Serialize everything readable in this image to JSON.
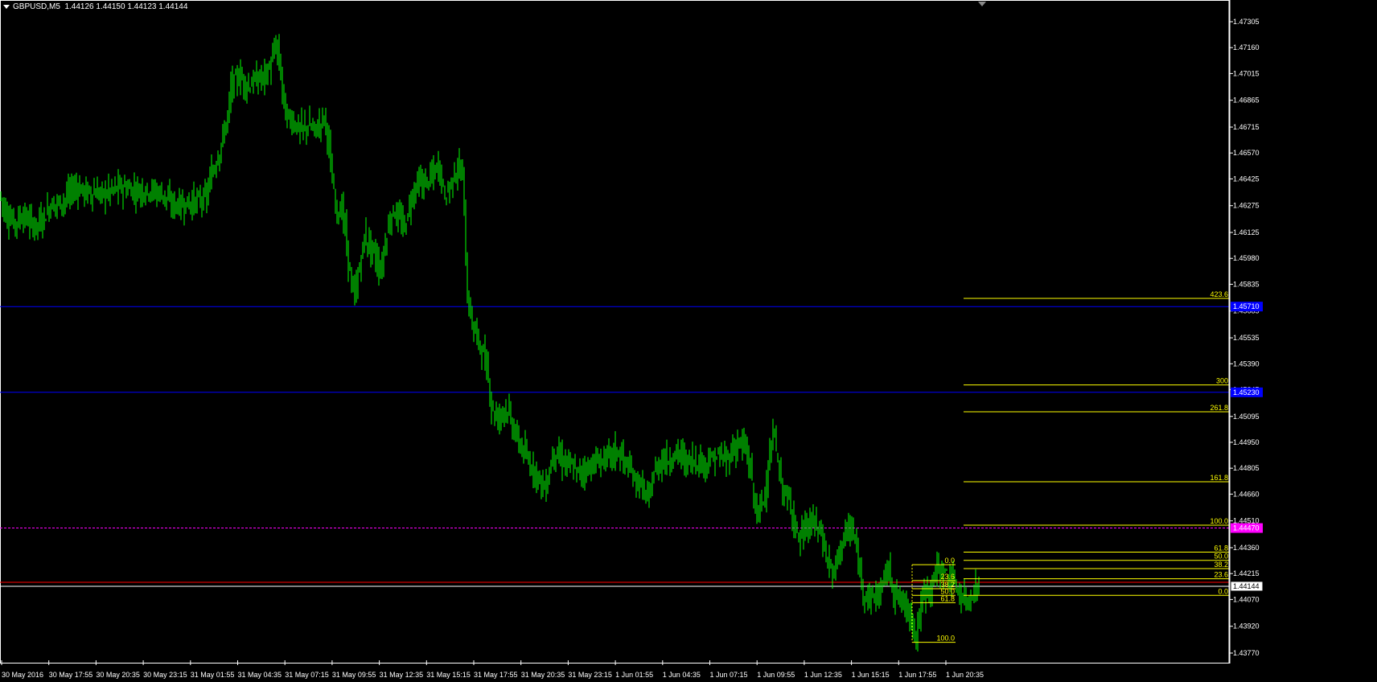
{
  "header": {
    "symbol": "GBPUSD,M5",
    "ohlc": "1.44126 1.44150 1.44123 1.44144"
  },
  "colors": {
    "background": "#000000",
    "candles": "#00ff00",
    "axis": "#ffffff",
    "support_line": "#0000ff",
    "fib": "#ffff00",
    "dashed_line": "#ff00ff",
    "bid_line": "#ff0000"
  },
  "chart_data": {
    "type": "bar",
    "symbol": "GBPUSD,M5",
    "ylim": [
      1.437,
      1.4738
    ],
    "y_ticks": [
      "1.47305",
      "1.47160",
      "1.47015",
      "1.46865",
      "1.46715",
      "1.46570",
      "1.46425",
      "1.46275",
      "1.46125",
      "1.45980",
      "1.45835",
      "1.45685",
      "1.45535",
      "1.45390",
      "1.45245",
      "1.45095",
      "1.44950",
      "1.44805",
      "1.44660",
      "1.44510",
      "1.44360",
      "1.44215",
      "1.44070",
      "1.43920",
      "1.43770"
    ],
    "x_ticks": [
      "30 May 2016",
      "30 May 17:55",
      "30 May 20:35",
      "30 May 23:15",
      "31 May 01:55",
      "31 May 04:35",
      "31 May 07:15",
      "31 May 09:55",
      "31 May 12:35",
      "31 May 15:15",
      "31 May 17:55",
      "31 May 20:35",
      "31 May 23:15",
      "1 Jun 01:55",
      "1 Jun 04:35",
      "1 Jun 07:15",
      "1 Jun 09:55",
      "1 Jun 12:35",
      "1 Jun 15:15",
      "1 Jun 17:55",
      "1 Jun 20:35"
    ],
    "x_range": [
      0,
      1522
    ],
    "price_path": [
      [
        0,
        1.4636
      ],
      [
        10,
        1.4622
      ],
      [
        20,
        1.4618
      ],
      [
        30,
        1.4622
      ],
      [
        45,
        1.4616
      ],
      [
        55,
        1.462
      ],
      [
        65,
        1.4628
      ],
      [
        80,
        1.463
      ],
      [
        95,
        1.4638
      ],
      [
        110,
        1.4635
      ],
      [
        130,
        1.4634
      ],
      [
        150,
        1.4638
      ],
      [
        170,
        1.4636
      ],
      [
        190,
        1.4636
      ],
      [
        205,
        1.4634
      ],
      [
        215,
        1.4628
      ],
      [
        230,
        1.4628
      ],
      [
        245,
        1.463
      ],
      [
        258,
        1.4632
      ],
      [
        265,
        1.4645
      ],
      [
        275,
        1.4658
      ],
      [
        285,
        1.4678
      ],
      [
        290,
        1.4696
      ],
      [
        300,
        1.47
      ],
      [
        310,
        1.4694
      ],
      [
        320,
        1.4698
      ],
      [
        330,
        1.47
      ],
      [
        338,
        1.4705
      ],
      [
        345,
        1.4718
      ],
      [
        350,
        1.4705
      ],
      [
        357,
        1.4678
      ],
      [
        365,
        1.4675
      ],
      [
        375,
        1.467
      ],
      [
        385,
        1.4672
      ],
      [
        395,
        1.467
      ],
      [
        405,
        1.4678
      ],
      [
        410,
        1.4665
      ],
      [
        415,
        1.464
      ],
      [
        420,
        1.4625
      ],
      [
        428,
        1.4625
      ],
      [
        433,
        1.4605
      ],
      [
        438,
        1.4585
      ],
      [
        442,
        1.4576
      ],
      [
        448,
        1.459
      ],
      [
        455,
        1.461
      ],
      [
        462,
        1.4605
      ],
      [
        468,
        1.46
      ],
      [
        475,
        1.459
      ],
      [
        482,
        1.461
      ],
      [
        490,
        1.4625
      ],
      [
        498,
        1.462
      ],
      [
        505,
        1.4615
      ],
      [
        512,
        1.463
      ],
      [
        520,
        1.464
      ],
      [
        530,
        1.464
      ],
      [
        540,
        1.4645
      ],
      [
        548,
        1.465
      ],
      [
        555,
        1.4632
      ],
      [
        562,
        1.464
      ],
      [
        570,
        1.4648
      ],
      [
        578,
        1.4645
      ],
      [
        580,
        1.4608
      ],
      [
        583,
        1.4575
      ],
      [
        590,
        1.456
      ],
      [
        600,
        1.4548
      ],
      [
        608,
        1.4535
      ],
      [
        613,
        1.4515
      ],
      [
        620,
        1.4508
      ],
      [
        630,
        1.4515
      ],
      [
        635,
        1.451
      ],
      [
        642,
        1.45
      ],
      [
        650,
        1.4492
      ],
      [
        660,
        1.4483
      ],
      [
        670,
        1.4477
      ],
      [
        680,
        1.4468
      ],
      [
        690,
        1.449
      ],
      [
        700,
        1.4485
      ],
      [
        710,
        1.4482
      ],
      [
        720,
        1.4478
      ],
      [
        730,
        1.448
      ],
      [
        740,
        1.4483
      ],
      [
        750,
        1.4485
      ],
      [
        760,
        1.4488
      ],
      [
        770,
        1.449
      ],
      [
        780,
        1.4483
      ],
      [
        790,
        1.4475
      ],
      [
        800,
        1.447
      ],
      [
        808,
        1.4462
      ],
      [
        815,
        1.4478
      ],
      [
        825,
        1.4485
      ],
      [
        835,
        1.4485
      ],
      [
        845,
        1.449
      ],
      [
        855,
        1.4484
      ],
      [
        865,
        1.4485
      ],
      [
        875,
        1.4483
      ],
      [
        885,
        1.4485
      ],
      [
        895,
        1.4487
      ],
      [
        905,
        1.4485
      ],
      [
        912,
        1.449
      ],
      [
        920,
        1.4495
      ],
      [
        928,
        1.4492
      ],
      [
        935,
        1.448
      ],
      [
        940,
        1.446
      ],
      [
        945,
        1.4455
      ],
      [
        952,
        1.4465
      ],
      [
        958,
        1.4485
      ],
      [
        965,
        1.45
      ],
      [
        970,
        1.4478
      ],
      [
        978,
        1.4465
      ],
      [
        985,
        1.446
      ],
      [
        995,
        1.444
      ],
      [
        1005,
        1.4448
      ],
      [
        1015,
        1.445
      ],
      [
        1022,
        1.4445
      ],
      [
        1030,
        1.443
      ],
      [
        1038,
        1.442
      ],
      [
        1045,
        1.4435
      ],
      [
        1055,
        1.4445
      ],
      [
        1062,
        1.4446
      ],
      [
        1068,
        1.443
      ],
      [
        1075,
        1.4412
      ],
      [
        1085,
        1.4408
      ],
      [
        1095,
        1.441
      ],
      [
        1105,
        1.4425
      ],
      [
        1115,
        1.441
      ],
      [
        1125,
        1.4405
      ],
      [
        1135,
        1.4398
      ],
      [
        1141,
        1.4385
      ],
      [
        1145,
        1.4398
      ],
      [
        1150,
        1.441
      ],
      [
        1160,
        1.4415
      ],
      [
        1168,
        1.4425
      ],
      [
        1175,
        1.4422
      ],
      [
        1185,
        1.4418
      ],
      [
        1195,
        1.441
      ],
      [
        1203,
        1.4406
      ],
      [
        1210,
        1.441
      ],
      [
        1218,
        1.4414
      ]
    ],
    "horizontal_lines": [
      {
        "price": 1.4571,
        "color": "#0000ff",
        "label": "1.45710"
      },
      {
        "price": 1.4523,
        "color": "#0000ff",
        "label": "1.45230"
      },
      {
        "price": 1.4447,
        "color": "#ff00ff",
        "label": "1.44470",
        "dashed": true
      },
      {
        "price": 1.44166,
        "color": "#ff0000"
      },
      {
        "price": 1.44144,
        "color": "#ffffff",
        "label": "1.44144"
      }
    ],
    "fib_large": {
      "x_start": 1198,
      "x_end": 1528,
      "levels": [
        {
          "label": "423.6",
          "price": 1.45756
        },
        {
          "label": "300",
          "price": 1.45271
        },
        {
          "label": "261.8",
          "price": 1.45121
        },
        {
          "label": "161.8",
          "price": 1.44729
        },
        {
          "label": "100.0",
          "price": 1.44486
        },
        {
          "label": "61.8",
          "price": 1.44335
        },
        {
          "label": "50.0",
          "price": 1.44289
        },
        {
          "label": "38.2",
          "price": 1.44243
        },
        {
          "label": "23.6",
          "price": 1.44186
        },
        {
          "label": "0.0",
          "price": 1.44093
        }
      ]
    },
    "fib_small": {
      "x_start": 1134,
      "x_end": 1188,
      "levels": [
        {
          "label": "0.0",
          "price": 1.44265
        },
        {
          "label": "23.6",
          "price": 1.44176
        },
        {
          "label": "38.2",
          "price": 1.4413
        },
        {
          "label": "50.0",
          "price": 1.44093
        },
        {
          "label": "61.8",
          "price": 1.44052
        },
        {
          "label": "100.0",
          "price": 1.4383
        }
      ]
    }
  }
}
